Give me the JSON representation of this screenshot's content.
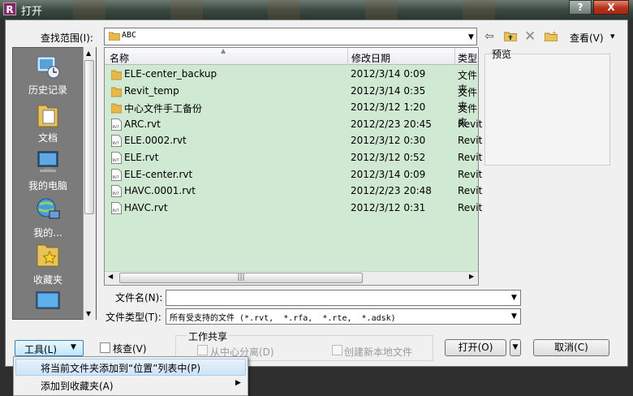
{
  "window": {
    "title": "打开",
    "app_icon": "R",
    "help": "?",
    "close": "X"
  },
  "lookin": {
    "label": "查找范围(I):",
    "value": "ABC"
  },
  "toolbar": {
    "view_label": "查看(V)",
    "back": "⇦",
    "delete": "✕",
    "view_arrow": "▾"
  },
  "places": [
    {
      "label": "历史记录",
      "icon": "history-icon"
    },
    {
      "label": "文档",
      "icon": "documents-icon"
    },
    {
      "label": "我的电脑",
      "icon": "computer-icon"
    },
    {
      "label": "我的...",
      "icon": "network-icon"
    },
    {
      "label": "收藏夹",
      "icon": "favorites-icon"
    }
  ],
  "columns": {
    "name": "名称",
    "date": "修改日期",
    "type": "类型"
  },
  "files": [
    {
      "name": "ELE-center_backup",
      "date": "2012/3/14 0:09",
      "type": "文件夹",
      "kind": "folder"
    },
    {
      "name": "Revit_temp",
      "date": "2012/3/14 0:35",
      "type": "文件夹",
      "kind": "folder"
    },
    {
      "name": "中心文件手工备份",
      "date": "2012/3/12 1:20",
      "type": "文件夹",
      "kind": "folder"
    },
    {
      "name": "ARC.rvt",
      "date": "2012/2/23 20:45",
      "type": "Revit",
      "kind": "rvt"
    },
    {
      "name": "ELE.0002.rvt",
      "date": "2012/3/12 0:30",
      "type": "Revit",
      "kind": "rvt"
    },
    {
      "name": "ELE.rvt",
      "date": "2012/3/12 0:52",
      "type": "Revit",
      "kind": "rvt"
    },
    {
      "name": "ELE-center.rvt",
      "date": "2012/3/14 0:09",
      "type": "Revit",
      "kind": "rvt"
    },
    {
      "name": "HAVC.0001.rvt",
      "date": "2012/2/23 20:48",
      "type": "Revit",
      "kind": "rvt"
    },
    {
      "name": "HAVC.rvt",
      "date": "2012/3/12 0:31",
      "type": "Revit",
      "kind": "rvt"
    }
  ],
  "preview": {
    "label": "预览"
  },
  "filename": {
    "label": "文件名(N):",
    "value": ""
  },
  "filetype": {
    "label": "文件类型(T):",
    "value": "所有受支持的文件 (*.rvt,  *.rfa,  *.rte,  *.adsk)"
  },
  "buttons": {
    "tools": "工具(L)",
    "open": "打开(O)",
    "cancel": "取消(C)"
  },
  "verify": {
    "label": "核查(V)"
  },
  "worksharing": {
    "title": "工作共享",
    "detach": "从中心分离(D)",
    "create_local": "创建新本地文件"
  },
  "menu": {
    "items": [
      {
        "label": "将当前文件夹添加到“位置”列表中(P)"
      },
      {
        "label": "添加到收藏夹(A)"
      }
    ]
  },
  "colors": {
    "list_bg": "#cfe9d2",
    "places_bg": "#7b7b7b",
    "highlight": "#cde3f7"
  }
}
